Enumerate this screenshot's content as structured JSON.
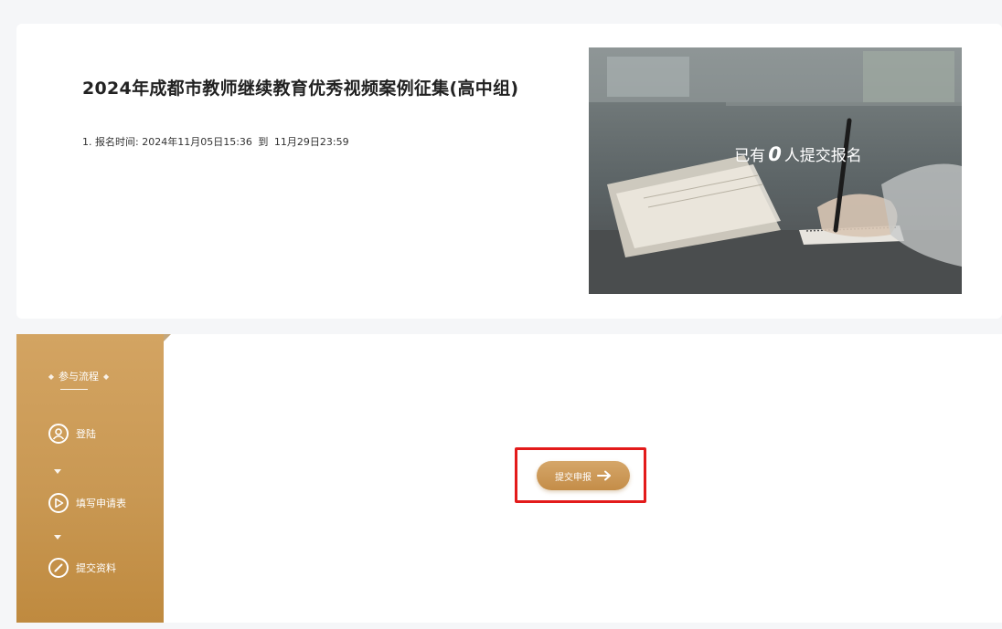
{
  "event": {
    "title": "2024年成都市教师继续教育优秀视频案例征集(高中组)",
    "reg_time_label": "1. 报名时间:",
    "reg_start": "2024年11月05日15:36",
    "reg_sep": "到",
    "reg_end": "11月29日23:59"
  },
  "hero": {
    "prefix": "已有",
    "count": "0",
    "suffix": "人提交报名"
  },
  "sidebar": {
    "flow_title": "参与流程",
    "steps": [
      {
        "label": "登陆",
        "icon": "user-icon"
      },
      {
        "label": "填写申请表",
        "icon": "play-icon"
      },
      {
        "label": "提交资料",
        "icon": "pencil-icon"
      }
    ]
  },
  "action": {
    "submit_label": "提交申报",
    "icon": "arrow-right-icon"
  },
  "colors": {
    "accent": "#c99853",
    "highlight": "#e31b1b"
  }
}
